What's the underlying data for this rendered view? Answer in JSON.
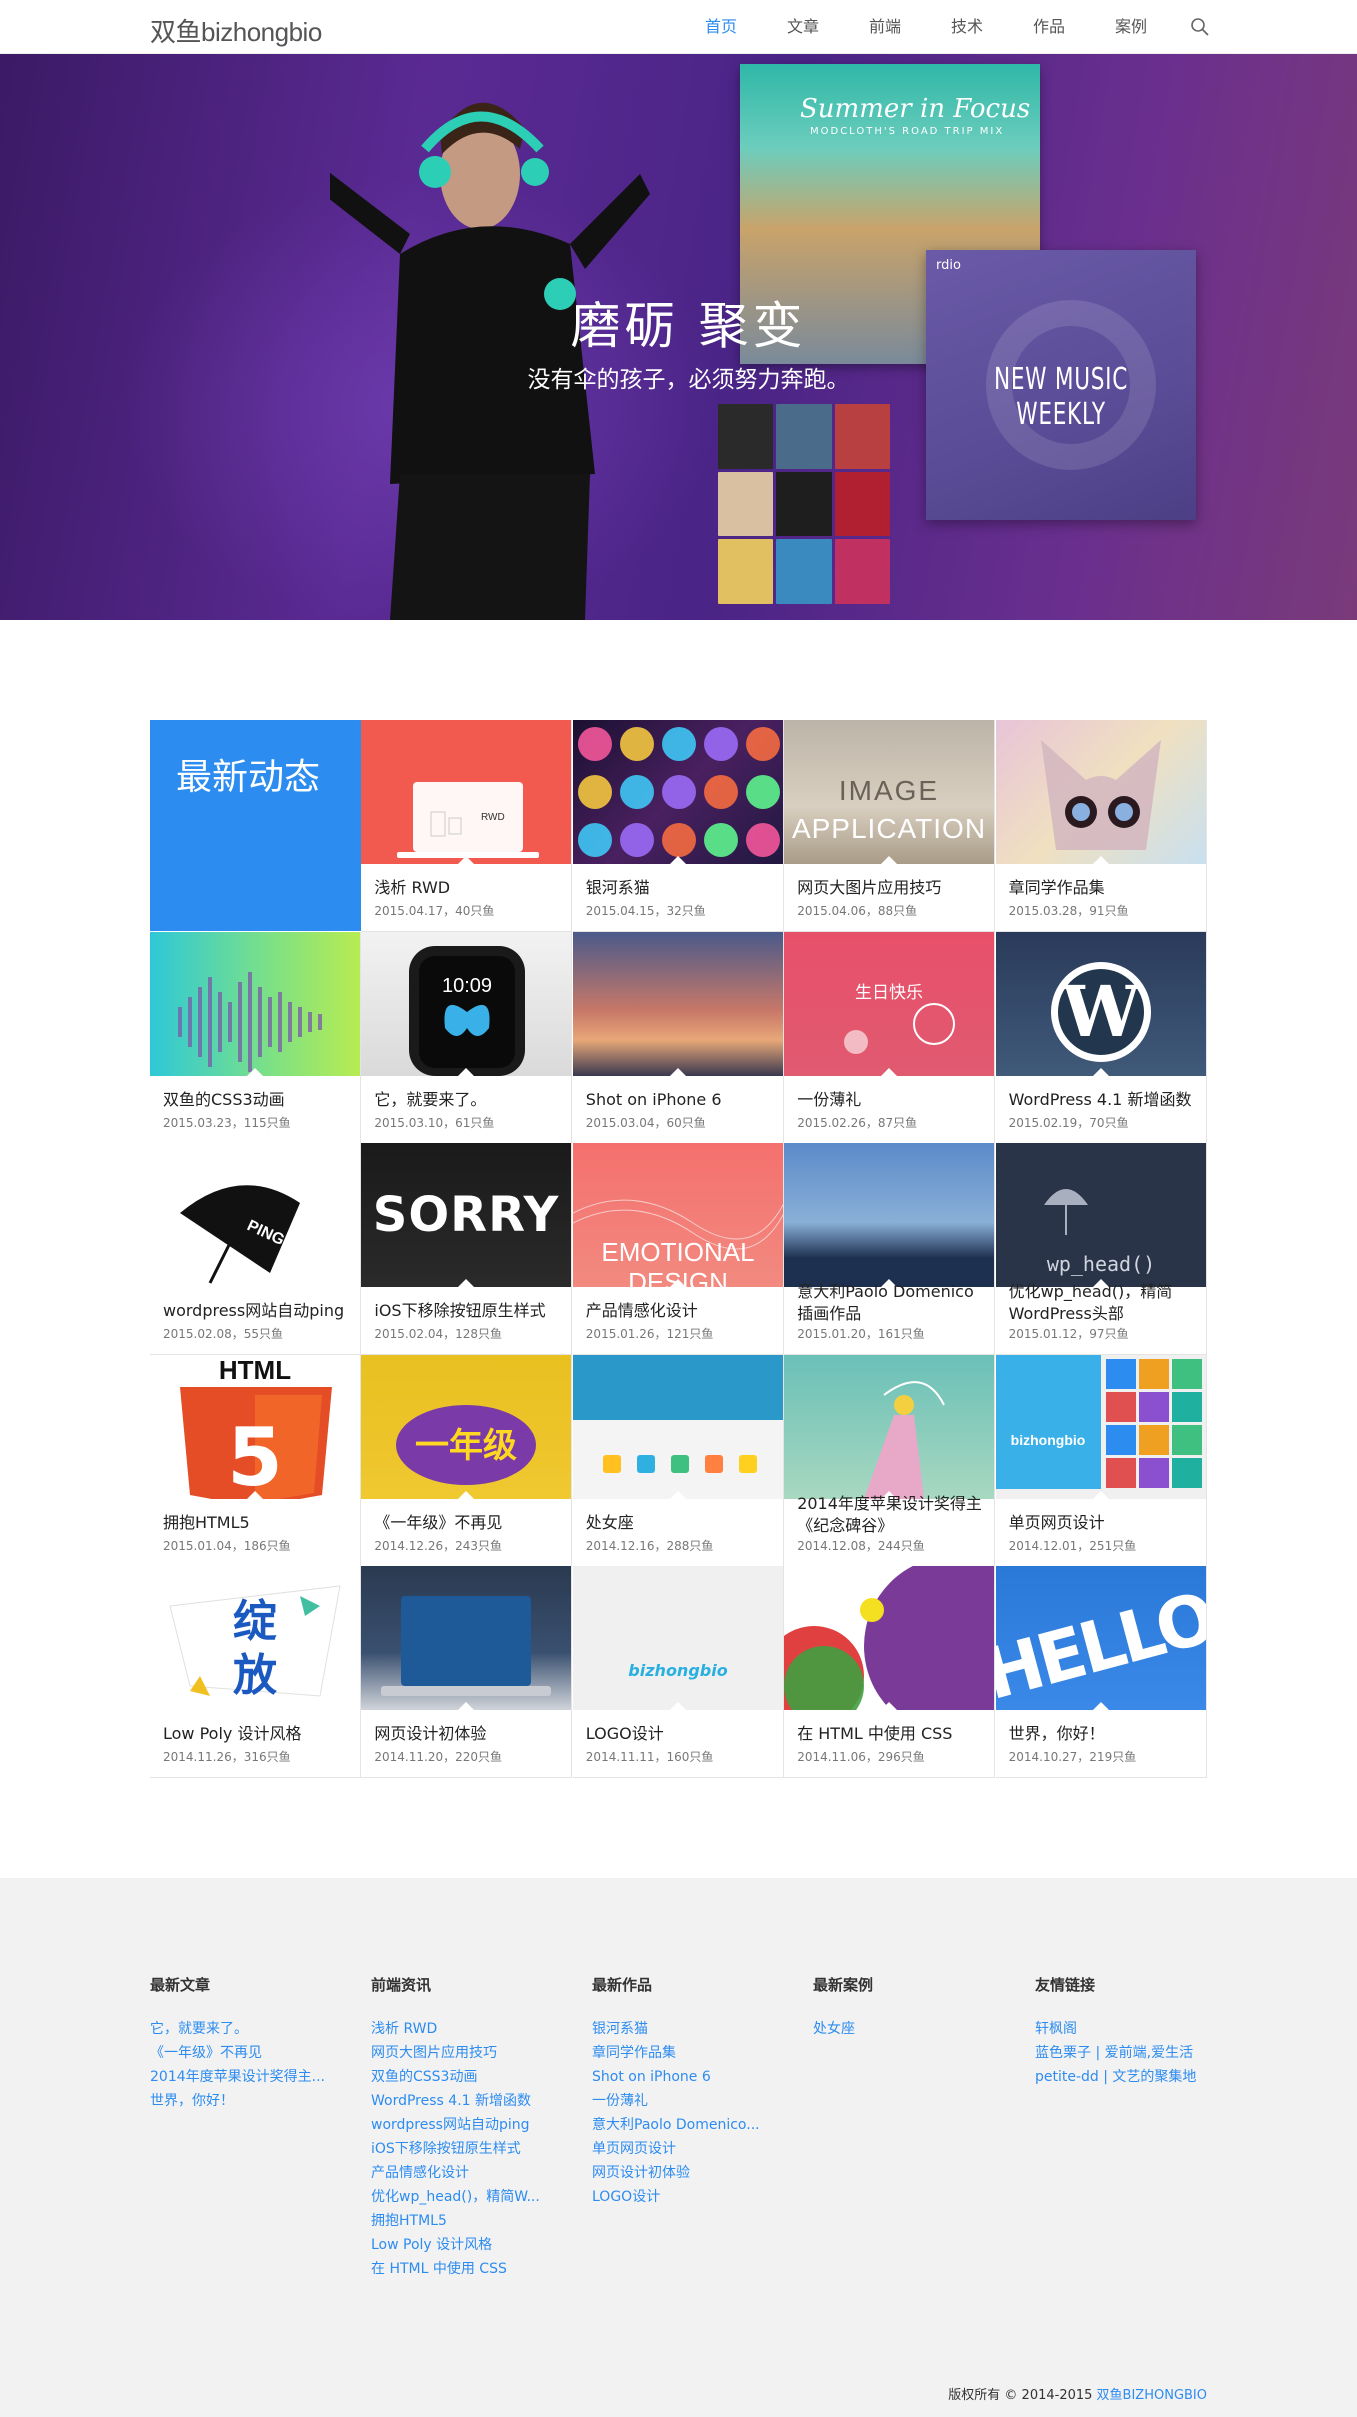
{
  "brand": {
    "logo": "双鱼bizhongbio",
    "accent": "#2d8cf0"
  },
  "nav": {
    "items": [
      "首页",
      "文章",
      "前端",
      "技术",
      "作品",
      "案例"
    ],
    "active": "首页",
    "search_icon": "search-icon"
  },
  "banner": {
    "title": "磨砺 聚变",
    "subtitle": "没有伞的孩子，必须努力奔跑。",
    "card_summer_title": "Summer in Focus",
    "card_summer_sub": "MODCLOTH'S ROAD TRIP MIX",
    "card_music_logo": "rdio",
    "card_music_title": "NEW MUSIC WEEKLY"
  },
  "grid": {
    "feature_label": "最新动态",
    "tiles": [
      {
        "title": "浅析 RWD",
        "meta": "2015.04.17，40只鱼"
      },
      {
        "title": "银河系猫",
        "meta": "2015.04.15，32只鱼"
      },
      {
        "title": "网页大图片应用技巧",
        "meta": "2015.04.06，88只鱼",
        "thumb_text": "IMAGE APPLICATION"
      },
      {
        "title": "章同学作品集",
        "meta": "2015.03.28，91只鱼"
      },
      {
        "title": "双鱼的CSS3动画",
        "meta": "2015.03.23，115只鱼"
      },
      {
        "title": "它，就要来了。",
        "meta": "2015.03.10，61只鱼",
        "thumb_text": "10:09"
      },
      {
        "title": "Shot on iPhone 6",
        "meta": "2015.03.04，60只鱼"
      },
      {
        "title": "一份薄礼",
        "meta": "2015.02.26，87只鱼",
        "thumb_text": "生日快乐"
      },
      {
        "title": "WordPress 4.1 新增函数",
        "meta": "2015.02.19，70只鱼"
      },
      {
        "title": "wordpress网站自动ping",
        "meta": "2015.02.08，55只鱼",
        "thumb_text": "PING"
      },
      {
        "title": "iOS下移除按钮原生样式",
        "meta": "2015.02.04，128只鱼",
        "thumb_text": "SORRY"
      },
      {
        "title": "产品情感化设计",
        "meta": "2015.01.26，121只鱼",
        "thumb_text": "EMOTIONAL DESIGN"
      },
      {
        "title": "意大利Paolo Domenico插画作品",
        "meta": "2015.01.20，161只鱼"
      },
      {
        "title": "优化wp_head()，精简WordPress头部",
        "meta": "2015.01.12，97只鱼",
        "thumb_text": "wp_head()"
      },
      {
        "title": "拥抱HTML5",
        "meta": "2015.01.04，186只鱼",
        "thumb_text": "HTML"
      },
      {
        "title": "《一年级》不再见",
        "meta": "2014.12.26，243只鱼",
        "thumb_text": "一年级"
      },
      {
        "title": "处女座",
        "meta": "2014.12.16，288只鱼"
      },
      {
        "title": "2014年度苹果设计奖得主《纪念碑谷》",
        "meta": "2014.12.08，244只鱼"
      },
      {
        "title": "单页网页设计",
        "meta": "2014.12.01，251只鱼",
        "thumb_text": "bizhongbio"
      },
      {
        "title": "Low Poly 设计风格",
        "meta": "2014.11.26，316只鱼",
        "thumb_text": "绽放"
      },
      {
        "title": "网页设计初体验",
        "meta": "2014.11.20，220只鱼"
      },
      {
        "title": "LOGO设计",
        "meta": "2014.11.11，160只鱼",
        "thumb_text": "bizhongbio"
      },
      {
        "title": "在 HTML 中使用 CSS",
        "meta": "2014.11.06，296只鱼"
      },
      {
        "title": "世界，你好！",
        "meta": "2014.10.27，219只鱼",
        "thumb_text": "HELLO"
      }
    ]
  },
  "footer": {
    "columns": [
      {
        "heading": "最新文章",
        "links": [
          "它，就要来了。",
          "《一年级》不再见",
          "2014年度苹果设计奖得主...",
          "世界，你好！"
        ]
      },
      {
        "heading": "前端资讯",
        "links": [
          "浅析 RWD",
          "网页大图片应用技巧",
          "双鱼的CSS3动画",
          "WordPress 4.1 新增函数",
          "wordpress网站自动ping",
          "iOS下移除按钮原生样式",
          "产品情感化设计",
          "优化wp_head()，精简W...",
          "拥抱HTML5",
          "Low Poly 设计风格",
          "在 HTML 中使用 CSS"
        ]
      },
      {
        "heading": "最新作品",
        "links": [
          "银河系猫",
          "章同学作品集",
          "Shot on iPhone 6",
          "一份薄礼",
          "意大利Paolo Domenico...",
          "单页网页设计",
          "网页设计初体验",
          "LOGO设计"
        ]
      },
      {
        "heading": "最新案例",
        "links": [
          "处女座"
        ]
      },
      {
        "heading": "友情链接",
        "links": [
          "轩枫阁",
          "蓝色栗子 | 爱前端,爱生活",
          "petite-dd | 文艺的聚集地"
        ]
      }
    ],
    "copyright": "版权所有 © 2014-2015",
    "copyright_brand": "双鱼BIZHONGBIO"
  }
}
